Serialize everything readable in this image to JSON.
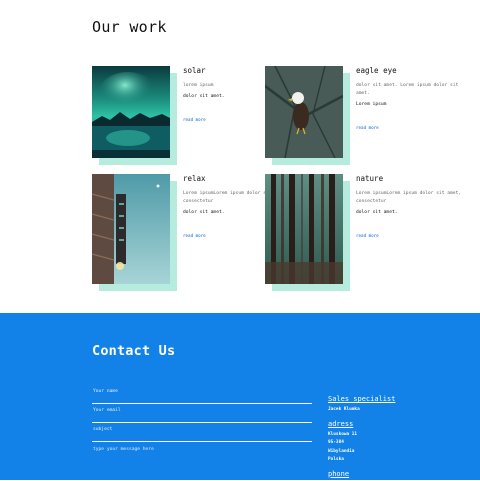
{
  "work": {
    "title": "Our work",
    "cards": [
      {
        "title": "solar",
        "desc": "lorem ipsum",
        "desc2": "dolor sit amet.",
        "link": "read more",
        "image": "aurora-lake-photo"
      },
      {
        "title": "eagle eye",
        "desc": "dolor sit amet. Lorem ipsum dolor sit amet.",
        "desc2": "Lorem ipsum",
        "link": "read more",
        "image": "bald-eagle-photo"
      },
      {
        "title": "relax",
        "desc": "Lorem ipsumLorem ipsum dolor sit amet, consectetur",
        "desc2": "dolor sit amet.",
        "link": "read more",
        "image": "neon-sign-photo"
      },
      {
        "title": "nature",
        "desc": "Lorem ipsumLorem ipsum dolor sit amet, consectetur",
        "desc2": "dolor sit amet.",
        "link": "read more",
        "image": "misty-forest-photo"
      }
    ]
  },
  "contact": {
    "title": "Contact Us",
    "name_placeholder": "Your name",
    "email_placeholder": "Your email",
    "subject_placeholder": "subject",
    "message_placeholder": "type your message here",
    "info": {
      "role_heading": "Sales specialist",
      "role_name": "Jacek Klumka",
      "address_heading": "adress",
      "address_line1": "Kluskowa 11",
      "address_line2": "95-384",
      "address_line3": "Wibylandia",
      "address_line4": "Polska",
      "phone_heading": "phone"
    }
  },
  "colors": {
    "accent": "#1382e8",
    "card_shadow": "#b6ecde",
    "link": "#0b63c4"
  }
}
